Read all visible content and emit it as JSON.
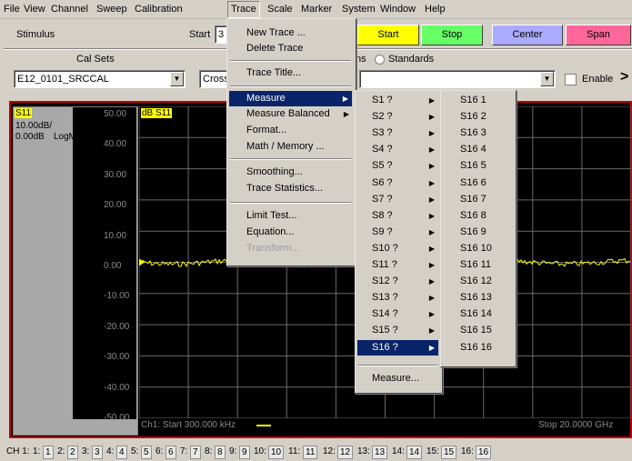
{
  "menubar": [
    "File",
    "View",
    "Channel",
    "Sweep",
    "Calibration",
    "Trace",
    "Scale",
    "Marker",
    "System",
    "Window",
    "Help"
  ],
  "menubar_active": "Trace",
  "toolbar": {
    "stimulus": "Stimulus",
    "start_label": "Start",
    "start_value": "3",
    "start_btn": "Start",
    "stop_btn": "Stop",
    "center_btn": "Center",
    "span_btn": "Span",
    "cal_sets": "Cal Sets",
    "cal_set_value": "E12_0101_SRCCAL",
    "cross_value": "Cross",
    "ns_fragment": "ns",
    "standards_label": "Standards",
    "enable_label": "Enable",
    "colors": {
      "start": "#ffff00",
      "stop": "#66ff66",
      "center": "#aaaaff",
      "span": "#ff6699"
    }
  },
  "trace": {
    "name": "S11",
    "scale": "10.00dB/",
    "ref": "0.00dB",
    "format": "LogM",
    "label": "dB S11",
    "ticks": [
      "50.00",
      "40.00",
      "30.00",
      "20.00",
      "10.00",
      "0.00",
      "-10.00",
      "-20.00",
      "-30.00",
      "-40.00",
      "-50.00"
    ],
    "footer_start": "Ch1: Start  300.000 kHz",
    "footer_stop": "Stop  20.0000 GHz",
    "color": "#ffff00"
  },
  "trace_menu": {
    "items": [
      "New Trace ...",
      "Delete Trace",
      "Trace Title...",
      "Measure",
      "Measure Balanced",
      "Format...",
      "Math / Memory ...",
      "Smoothing...",
      "Trace Statistics...",
      "Limit Test...",
      "Equation...",
      "Transform..."
    ]
  },
  "measure_menu": {
    "items": [
      "S1 ?",
      "S2 ?",
      "S3 ?",
      "S4 ?",
      "S5 ?",
      "S6 ?",
      "S7 ?",
      "S8 ?",
      "S9 ?",
      "S10 ?",
      "S11 ?",
      "S12 ?",
      "S13 ?",
      "S14 ?",
      "S15 ?",
      "S16 ?"
    ],
    "footer": "Measure..."
  },
  "s16_menu": {
    "items": [
      "S16 1",
      "S16 2",
      "S16 3",
      "S16 4",
      "S16 5",
      "S16 6",
      "S16 7",
      "S16 8",
      "S16 9",
      "S16 10",
      "S16 11",
      "S16 12",
      "S16 13",
      "S16 14",
      "S16 15",
      "S16 16"
    ]
  },
  "statusbar": {
    "prefix": "CH 1:",
    "channels": [
      {
        "label": "1:",
        "box": "1"
      },
      {
        "label": "2:",
        "box": "2"
      },
      {
        "label": "3:",
        "box": "3"
      },
      {
        "label": "4:",
        "box": "4"
      },
      {
        "label": "5:",
        "box": "5"
      },
      {
        "label": "6:",
        "box": "6"
      },
      {
        "label": "7:",
        "box": "7"
      },
      {
        "label": "8:",
        "box": "8"
      },
      {
        "label": "9:",
        "box": "9"
      },
      {
        "label": "10:",
        "box": "10"
      },
      {
        "label": "11:",
        "box": "11"
      },
      {
        "label": "12:",
        "box": "12"
      },
      {
        "label": "13:",
        "box": "13"
      },
      {
        "label": "14:",
        "box": "14"
      },
      {
        "label": "15:",
        "box": "15"
      },
      {
        "label": "16:",
        "box": "16"
      }
    ]
  }
}
